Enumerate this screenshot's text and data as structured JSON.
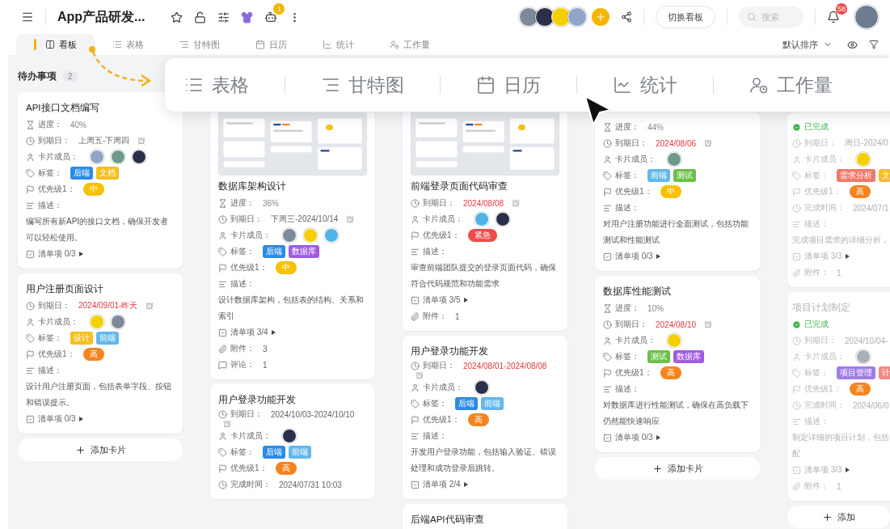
{
  "topbar": {
    "title": "App产品研发...",
    "robot_badge": "1",
    "members": [
      {
        "color": "#7d8a9c"
      },
      {
        "color": "#2a2f4a"
      },
      {
        "color": "#f5d000"
      },
      {
        "color": "#8fa6c8"
      }
    ],
    "switch_button": "切换看板",
    "search": {
      "placeholder": "搜索"
    },
    "notification_badge": "58",
    "user_avatar": {
      "color": "#6d7c90"
    }
  },
  "view_tabs": [
    {
      "label": "看板",
      "kind": "board",
      "selected": true
    },
    {
      "label": "表格",
      "kind": "table",
      "selected": false
    },
    {
      "label": "甘特图",
      "kind": "gantt",
      "selected": false
    },
    {
      "label": "日历",
      "kind": "calendar",
      "selected": false
    },
    {
      "label": "统计",
      "kind": "stats",
      "selected": false
    },
    {
      "label": "工作量",
      "kind": "workload",
      "selected": false
    }
  ],
  "sort": {
    "label": "默认排序"
  },
  "overlay_tabs": [
    {
      "label": "表格",
      "kind": "table"
    },
    {
      "label": "甘特图",
      "kind": "gantt"
    },
    {
      "label": "日历",
      "kind": "calendar"
    },
    {
      "label": "统计",
      "kind": "stats"
    },
    {
      "label": "工作量",
      "kind": "workload"
    }
  ],
  "columns": [
    {
      "title": "待办事项",
      "count": "2",
      "add_label": "添加卡片",
      "cards": [
        {
          "title": "API接口文档编写",
          "done": false,
          "fields": [
            {
              "kind": "progress",
              "label": "进度：",
              "value": "40%"
            },
            {
              "kind": "due",
              "label": "到期日：",
              "value": "上周五-下周四",
              "overdue": false
            },
            {
              "kind": "members",
              "label": "卡片成员：",
              "members": [
                {
                  "color": "#8fa6c8"
                },
                {
                  "color": "#6f9a8a"
                },
                {
                  "color": "#2a2f4a"
                }
              ]
            },
            {
              "kind": "tags",
              "label": "标签：",
              "tags": [
                {
                  "label": "后端",
                  "color": "#2b8be6"
                },
                {
                  "label": "文档",
                  "color": "#f5c020"
                }
              ]
            },
            {
              "kind": "priority",
              "label": "优先级1：",
              "value": "中",
              "color": "#f8c100"
            },
            {
              "kind": "desc",
              "label": "描述：",
              "value": "编写所有新API的接口文档，确保开发者可以轻松使用。"
            },
            {
              "kind": "checklist",
              "label": "清单项 0/3"
            }
          ]
        },
        {
          "title": "用户注册页面设计",
          "done": false,
          "fields": [
            {
              "kind": "due",
              "label": "到期日：",
              "value": "2024/09/01-昨天",
              "overdue": true
            },
            {
              "kind": "members",
              "label": "卡片成员：",
              "members": [
                {
                  "color": "#f5d000"
                },
                {
                  "color": "#7d8a9c"
                }
              ]
            },
            {
              "kind": "tags",
              "label": "标签：",
              "tags": [
                {
                  "label": "设计",
                  "color": "#f5c020"
                },
                {
                  "label": "前端",
                  "color": "#62b8ec"
                }
              ]
            },
            {
              "kind": "priority",
              "label": "优先级1：",
              "value": "高",
              "color": "#f5841f"
            },
            {
              "kind": "desc",
              "label": "描述：",
              "value": "设计用户注册页面，包括表单字段、按钮和错误提示。"
            },
            {
              "kind": "checklist",
              "label": "清单项 0/3"
            }
          ]
        }
      ]
    },
    {
      "cards": [
        {
          "title": "数据库架构设计",
          "cover": {
            "kind": "picture"
          },
          "done": false,
          "fields": [
            {
              "kind": "progress",
              "label": "进度：",
              "value": "36%"
            },
            {
              "kind": "due",
              "label": "到期日：",
              "value": "下周三-2024/10/14",
              "overdue": false
            },
            {
              "kind": "members",
              "label": "卡片成员：",
              "members": [
                {
                  "color": "#7d8a9c"
                },
                {
                  "color": "#f5d000"
                },
                {
                  "color": "#4fb3e8"
                }
              ]
            },
            {
              "kind": "tags",
              "label": "标签：",
              "tags": [
                {
                  "label": "后端",
                  "color": "#2b8be6"
                },
                {
                  "label": "数据库",
                  "color": "#a05ce0"
                }
              ]
            },
            {
              "kind": "priority",
              "label": "优先级1：",
              "value": "中",
              "color": "#f8c100"
            },
            {
              "kind": "desc",
              "label": "描述：",
              "value": "设计数据库架构，包括表的结构、关系和索引"
            },
            {
              "kind": "checklist",
              "label": "清单项 3/4"
            },
            {
              "kind": "attachments",
              "label": "附件：",
              "value": "3"
            },
            {
              "kind": "comments",
              "label": "评论：",
              "value": "1"
            }
          ]
        },
        {
          "title": "用户登录功能开发",
          "done": false,
          "fields": [
            {
              "kind": "due",
              "label": "到期日：",
              "value": "2024/10/03-2024/10/10",
              "overdue": false
            },
            {
              "kind": "members",
              "label": "卡片成员：",
              "members": [
                {
                  "color": "#2a2f4a"
                }
              ]
            },
            {
              "kind": "tags",
              "label": "标签：",
              "tags": [
                {
                  "label": "后端",
                  "color": "#2b8be6"
                },
                {
                  "label": "前端",
                  "color": "#62b8ec"
                }
              ]
            },
            {
              "kind": "priority",
              "label": "优先级1：",
              "value": "高",
              "color": "#f5841f"
            },
            {
              "kind": "done_time",
              "label": "完成时间：",
              "value": "2024/07/31 10:03"
            }
          ]
        }
      ]
    },
    {
      "cards": [
        {
          "title": "前端登录页面代码审查",
          "cover": {
            "kind": "picture"
          },
          "done": false,
          "fields": [
            {
              "kind": "due",
              "label": "到期日：",
              "value": "2024/08/08",
              "overdue": true
            },
            {
              "kind": "members",
              "label": "卡片成员：",
              "members": [
                {
                  "color": "#4fb3e8"
                },
                {
                  "color": "#2a2f4a"
                }
              ]
            },
            {
              "kind": "priority",
              "label": "优先级1：",
              "value": "紧急",
              "color": "#ef4b4b"
            },
            {
              "kind": "desc",
              "label": "描述：",
              "value": "审查前端团队提交的登录页面代码，确保符合代码规范和功能需求"
            },
            {
              "kind": "checklist",
              "label": "清单项 3/5"
            },
            {
              "kind": "attachments",
              "label": "附件：",
              "value": "1"
            }
          ]
        },
        {
          "title": "用户登录功能开发",
          "done": false,
          "fields": [
            {
              "kind": "due",
              "label": "到期日：",
              "value": "2024/08/01-2024/08/08",
              "overdue": true
            },
            {
              "kind": "members",
              "label": "卡片成员：",
              "members": [
                {
                  "color": "#2a2f4a"
                }
              ]
            },
            {
              "kind": "tags",
              "label": "标签：",
              "tags": [
                {
                  "label": "后端",
                  "color": "#2b8be6"
                },
                {
                  "label": "前端",
                  "color": "#62b8ec"
                }
              ]
            },
            {
              "kind": "priority",
              "label": "优先级1：",
              "value": "高",
              "color": "#f5841f"
            },
            {
              "kind": "desc",
              "label": "描述：",
              "value": "开发用户登录功能，包括输入验证、错误处理和成功登录后跳转。"
            },
            {
              "kind": "checklist",
              "label": "清单项 2/4"
            }
          ]
        },
        {
          "title": "后端API代码审查",
          "done": false
        }
      ]
    },
    {
      "add_label": "添加卡片",
      "cards": [
        {
          "done": false,
          "fields": [
            {
              "kind": "progress",
              "label": "进度：",
              "value": "44%"
            },
            {
              "kind": "due",
              "label": "到期日：",
              "value": "2024/08/06",
              "overdue": true
            },
            {
              "kind": "members",
              "label": "卡片成员：",
              "members": [
                {
                  "color": "#6f9a8a"
                }
              ]
            },
            {
              "kind": "tags",
              "label": "标签：",
              "tags": [
                {
                  "label": "前端",
                  "color": "#62b8ec"
                },
                {
                  "label": "测试",
                  "color": "#6cc04a"
                }
              ]
            },
            {
              "kind": "priority",
              "label": "优先级1：",
              "value": "中",
              "color": "#f8c100"
            },
            {
              "kind": "desc",
              "label": "描述：",
              "value": "对用户注册功能进行全面测试，包括功能测试和性能测试"
            },
            {
              "kind": "checklist",
              "label": "清单项 0/3"
            }
          ]
        },
        {
          "title": "数据库性能测试",
          "done": false,
          "fields": [
            {
              "kind": "progress",
              "label": "进度：",
              "value": "10%"
            },
            {
              "kind": "due",
              "label": "到期日：",
              "value": "2024/08/10",
              "overdue": true
            },
            {
              "kind": "members",
              "label": "卡片成员：",
              "members": [
                {
                  "color": "#f5d000"
                }
              ]
            },
            {
              "kind": "tags",
              "label": "标签：",
              "tags": [
                {
                  "label": "测试",
                  "color": "#6cc04a"
                },
                {
                  "label": "数据库",
                  "color": "#a05ce0"
                }
              ]
            },
            {
              "kind": "priority",
              "label": "优先级1：",
              "value": "高",
              "color": "#f5841f"
            },
            {
              "kind": "desc",
              "label": "描述：",
              "value": "对数据库进行性能测试，确保在高负载下仍然能快速响应"
            },
            {
              "kind": "checklist",
              "label": "清单项 0/3"
            }
          ]
        }
      ]
    },
    {
      "add_label": "添加",
      "cards": [
        {
          "done": true,
          "fields": [
            {
              "kind": "status",
              "label": "已完成"
            },
            {
              "kind": "due",
              "label": "到期日：",
              "value": "周日-2024/0",
              "overdue": false
            },
            {
              "kind": "members",
              "label": "卡片成员：",
              "members": [
                {
                  "color": "#f5d000"
                }
              ]
            },
            {
              "kind": "tags",
              "label": "标签：",
              "tags": [
                {
                  "label": "需求分析",
                  "color": "#f07a6a"
                },
                {
                  "label": "文",
                  "color": "#f5c020"
                }
              ]
            },
            {
              "kind": "priority",
              "label": "优先级1：",
              "value": "高",
              "color": "#f5841f"
            },
            {
              "kind": "done_time",
              "label": "完成时间：",
              "value": "2024/07/1"
            },
            {
              "kind": "desc",
              "label": "描述：",
              "value": "完成项目需求的详细分析，"
            },
            {
              "kind": "checklist",
              "label": "清单项 3/3"
            },
            {
              "kind": "attachments",
              "label": "附件：",
              "value": "1"
            }
          ]
        },
        {
          "title": "项目计划制定",
          "done": true,
          "fields": [
            {
              "kind": "status",
              "label": "已完成"
            },
            {
              "kind": "due",
              "label": "到期日：",
              "value": "2024/10/04-",
              "overdue": false
            },
            {
              "kind": "members",
              "label": "卡片成员：",
              "members": [
                {
                  "color": "#a8b0bc"
                }
              ]
            },
            {
              "kind": "tags",
              "label": "标签：",
              "tags": [
                {
                  "label": "项目管理",
                  "color": "#a07ce8"
                },
                {
                  "label": "计",
                  "color": "#f08a8a"
                }
              ]
            },
            {
              "kind": "priority",
              "label": "优先级1：",
              "value": "高",
              "color": "#f5841f"
            },
            {
              "kind": "done_time",
              "label": "完成时间：",
              "value": "2024/06/0"
            },
            {
              "kind": "desc",
              "label": "描述：",
              "value": [
                "制定详细的项目计划，包括",
                "配"
              ]
            },
            {
              "kind": "checklist",
              "label": "清单项 3/3"
            },
            {
              "kind": "attachments",
              "label": "附件：",
              "value": "1"
            }
          ]
        }
      ]
    }
  ]
}
